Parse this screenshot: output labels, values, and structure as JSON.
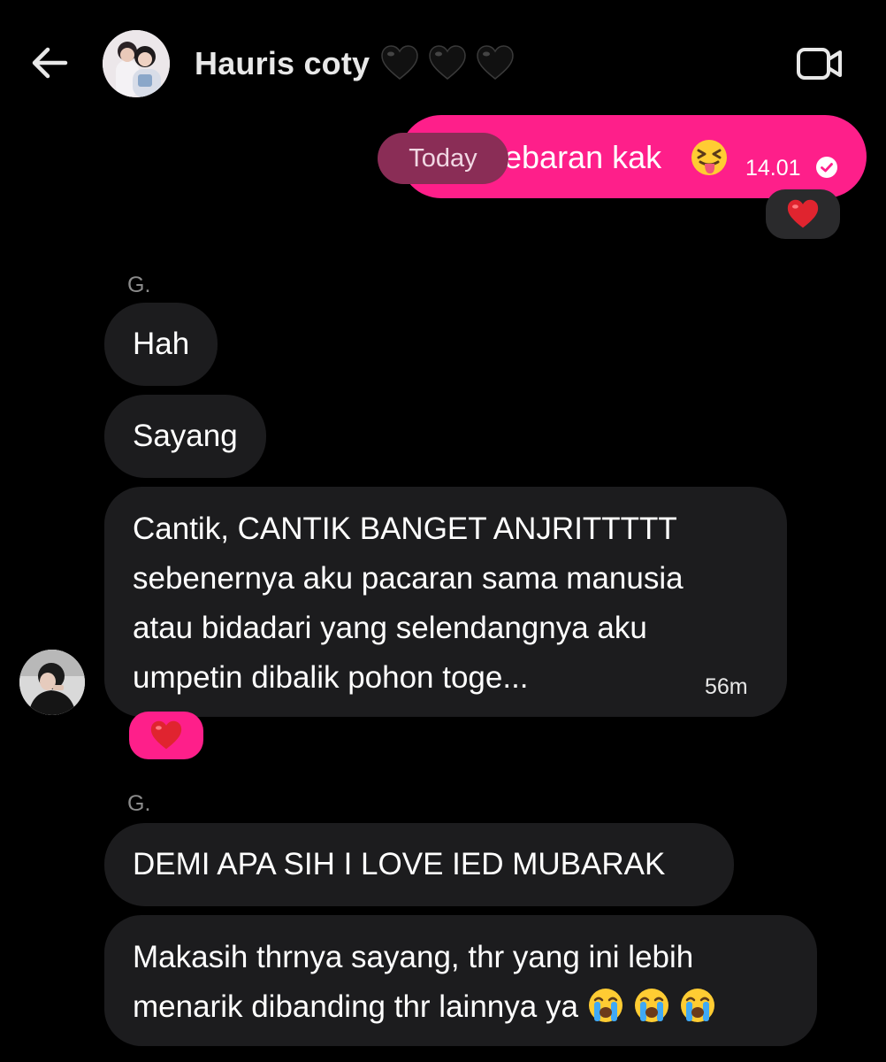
{
  "header": {
    "contact_name": "Hauris coty",
    "status_hearts": [
      "black-heart",
      "black-heart",
      "black-heart"
    ]
  },
  "outgoing": {
    "text_visible": "ebaran kak",
    "emoji": "squinting-tongue-face",
    "time": "14.01",
    "status": "read",
    "reaction": "red-heart",
    "bubble_color": "#fe1f8a"
  },
  "date_separator": "Today",
  "incoming": {
    "groups": [
      {
        "sender": "G.",
        "messages": [
          {
            "lines": [
              "Hah"
            ]
          },
          {
            "lines": [
              "Sayang"
            ]
          },
          {
            "lines": [
              "Cantik, CANTIK BANGET ANJRITTTTT",
              "sebenernya aku pacaran sama manusia",
              "atau bidadari yang selendangnya aku",
              "umpetin dibalik pohon toge..."
            ],
            "time": "56m",
            "reaction": "red-heart"
          }
        ]
      },
      {
        "sender": "G.",
        "messages": [
          {
            "lines": [
              "DEMI APA SIH I LOVE IED MUBARAK"
            ]
          },
          {
            "lines": [
              "Makasih thrnya sayang, thr yang ini lebih",
              "menarik dibanding thr lainnya ya"
            ],
            "emojis": [
              "loudly-crying-face",
              "loudly-crying-face",
              "loudly-crying-face"
            ]
          }
        ]
      }
    ],
    "bubble_color": "#1c1c1e"
  },
  "colors": {
    "background": "#000000",
    "accent_pink": "#fe1f8a",
    "today_pill": "#8a2d56",
    "muted_text": "#8b8b8b"
  }
}
